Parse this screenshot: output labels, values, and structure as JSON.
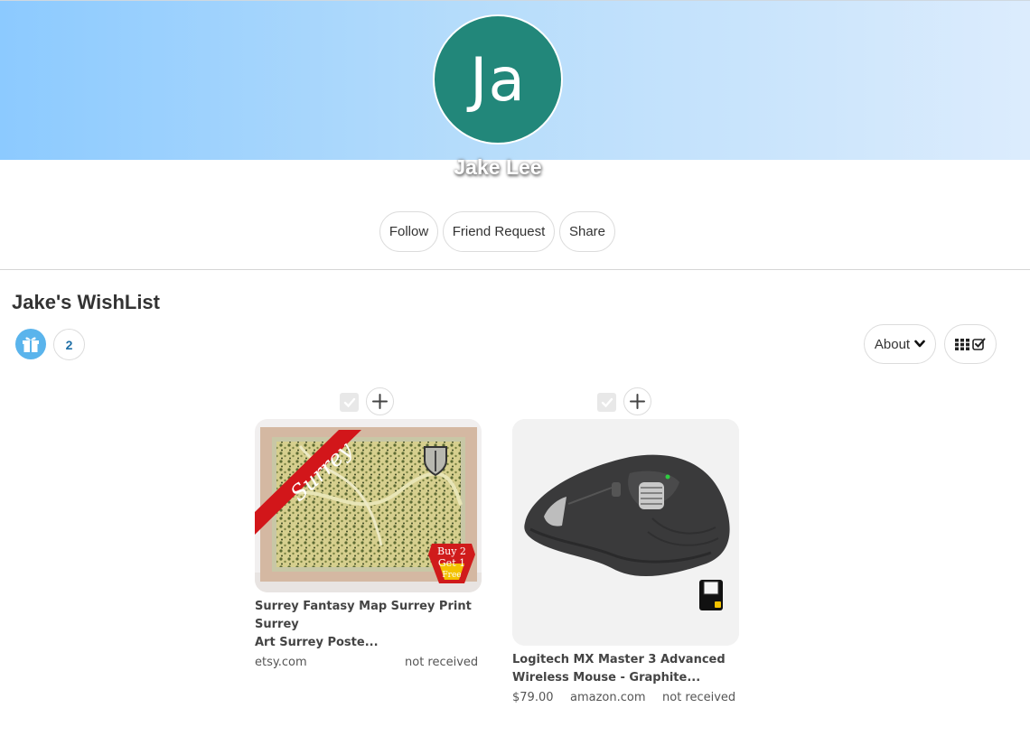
{
  "profile": {
    "initials": "Ja",
    "name": "Jake Lee",
    "avatar_color": "#22877a",
    "banner_colors": [
      "#8ccaff",
      "#dcecfd"
    ]
  },
  "actions": {
    "follow": "Follow",
    "friend_request": "Friend Request",
    "share": "Share"
  },
  "wishlist": {
    "title": "Jake's WishList",
    "gift_icon": "gift-icon",
    "count": "2",
    "about_label": "About",
    "view_icon": "grid-check-icon"
  },
  "items": [
    {
      "title_line1": "Surrey Fantasy Map Surrey Print Surrey",
      "title_line2": "Art Surrey Poste...",
      "price": "",
      "store": "etsy.com",
      "status": "not received",
      "image_ribbon": "Surrey",
      "image_badge": [
        "Buy 2",
        "Get 1",
        "Free"
      ]
    },
    {
      "title_line1": "Logitech MX Master 3 Advanced",
      "title_line2": "Wireless Mouse - Graphite...",
      "price": "$79.00",
      "store": "amazon.com",
      "status": "not received"
    }
  ]
}
